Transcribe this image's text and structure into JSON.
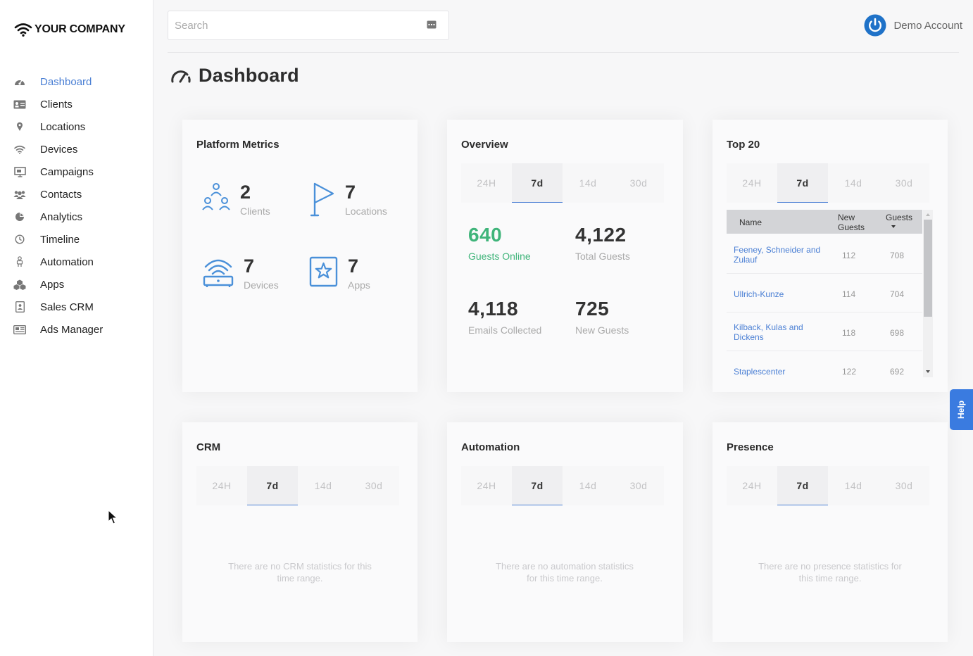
{
  "brand": {
    "name": "YOUR COMPANY"
  },
  "search": {
    "placeholder": "Search"
  },
  "account": {
    "name": "Demo Account"
  },
  "page": {
    "title": "Dashboard"
  },
  "sidebar": {
    "items": [
      {
        "label": "Dashboard",
        "icon": "dashboard-icon",
        "active": true
      },
      {
        "label": "Clients",
        "icon": "id-card-icon"
      },
      {
        "label": "Locations",
        "icon": "map-pin-icon"
      },
      {
        "label": "Devices",
        "icon": "wifi-icon"
      },
      {
        "label": "Campaigns",
        "icon": "presentation-icon"
      },
      {
        "label": "Contacts",
        "icon": "users-icon"
      },
      {
        "label": "Analytics",
        "icon": "pie-chart-icon"
      },
      {
        "label": "Timeline",
        "icon": "clock-icon"
      },
      {
        "label": "Automation",
        "icon": "robot-icon"
      },
      {
        "label": "Apps",
        "icon": "cubes-icon"
      },
      {
        "label": "Sales CRM",
        "icon": "contact-book-icon"
      },
      {
        "label": "Ads Manager",
        "icon": "newspaper-icon"
      }
    ]
  },
  "tabs": [
    "24H",
    "7d",
    "14d",
    "30d"
  ],
  "platform_metrics": {
    "title": "Platform Metrics",
    "clients": {
      "value": "2",
      "label": "Clients"
    },
    "locations": {
      "value": "7",
      "label": "Locations"
    },
    "devices": {
      "value": "7",
      "label": "Devices"
    },
    "apps": {
      "value": "7",
      "label": "Apps"
    }
  },
  "overview": {
    "title": "Overview",
    "guests_online": {
      "value": "640",
      "label": "Guests Online"
    },
    "total_guests": {
      "value": "4,122",
      "label": "Total Guests"
    },
    "emails": {
      "value": "4,118",
      "label": "Emails Collected"
    },
    "new_guests": {
      "value": "725",
      "label": "New Guests"
    }
  },
  "top20": {
    "title": "Top 20",
    "columns": [
      "Name",
      "New Guests",
      "Guests"
    ],
    "rows": [
      {
        "name": "Feeney, Schneider and Zulauf",
        "new": "112",
        "guests": "708"
      },
      {
        "name": "Ullrich-Kunze",
        "new": "114",
        "guests": "704"
      },
      {
        "name": "Kilback, Kulas and Dickens",
        "new": "118",
        "guests": "698"
      },
      {
        "name": "Staplescenter",
        "new": "122",
        "guests": "692"
      }
    ]
  },
  "crm": {
    "title": "CRM",
    "empty": "There are no CRM statistics for this time range."
  },
  "automation": {
    "title": "Automation",
    "empty": "There are no automation statistics for this time range."
  },
  "presence": {
    "title": "Presence",
    "empty": "There are no presence statistics for this time range."
  },
  "help": {
    "label": "Help"
  },
  "colors": {
    "accent": "#4a7fd4",
    "positive": "#3fb47a",
    "help_bg": "#3a7be0"
  }
}
